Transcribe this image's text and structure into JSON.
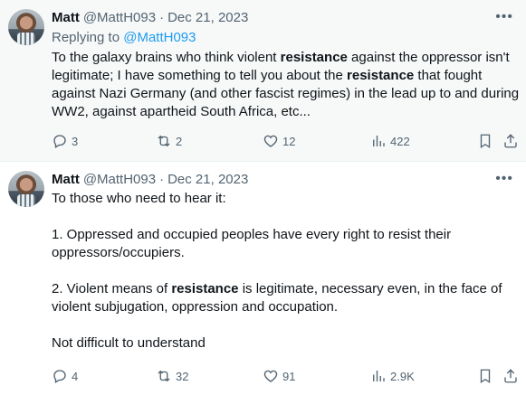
{
  "tweets": [
    {
      "author": "Matt",
      "handle": "@MattH093",
      "separator": "·",
      "date": "Dec 21, 2023",
      "replying_prefix": "Replying to",
      "replying_to": "@MattH093",
      "paragraphs": [
        [
          {
            "t": "To the galaxy brains who think violent "
          },
          {
            "t": "resistance",
            "b": true
          },
          {
            "t": " against the oppressor isn't legitimate; I have something to tell you about the "
          },
          {
            "t": "resistance",
            "b": true
          },
          {
            "t": " that fought against Nazi Germany (and other fascist regimes) in the lead up to and during WW2, against apartheid South Africa, etc..."
          }
        ]
      ],
      "stats": {
        "replies": "3",
        "reposts": "2",
        "likes": "12",
        "views": "422"
      }
    },
    {
      "author": "Matt",
      "handle": "@MattH093",
      "separator": "·",
      "date": "Dec 21, 2023",
      "paragraphs": [
        [
          {
            "t": "To those who need to hear it:"
          }
        ],
        [
          {
            "t": "1. Oppressed and occupied peoples have every right to resist their oppressors/occupiers."
          }
        ],
        [
          {
            "t": "2. Violent means of "
          },
          {
            "t": "resistance",
            "b": true
          },
          {
            "t": " is legitimate, necessary even, in the face of violent subjugation, oppression and occupation."
          }
        ],
        [
          {
            "t": "Not difficult to understand"
          }
        ]
      ],
      "stats": {
        "replies": "4",
        "reposts": "32",
        "likes": "91",
        "views": "2.9K"
      }
    }
  ],
  "icons": {
    "more": "more-horizontal-icon",
    "reply": "reply-icon",
    "repost": "repost-icon",
    "like": "heart-icon",
    "views": "views-icon",
    "bookmark": "bookmark-icon",
    "share": "share-icon"
  },
  "colors": {
    "text": "#0f1419",
    "secondary": "#536471",
    "link": "#1d9bf0",
    "highlight_bg": "#f7f9f9"
  }
}
